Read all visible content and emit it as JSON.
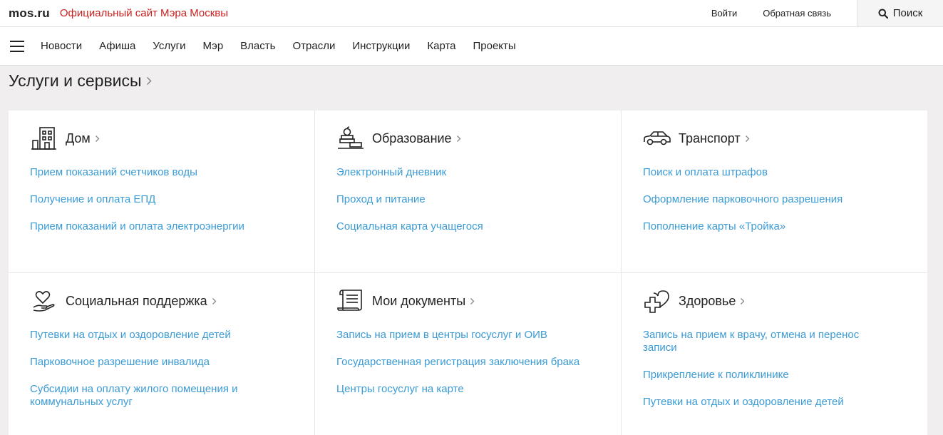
{
  "header": {
    "logo": "mos.ru",
    "site_title": "Официальный сайт Мэра Москвы",
    "login": "Войти",
    "feedback": "Обратная связь",
    "search": "Поиск"
  },
  "nav": {
    "items": [
      "Новости",
      "Афиша",
      "Услуги",
      "Мэр",
      "Власть",
      "Отрасли",
      "Инструкции",
      "Карта",
      "Проекты"
    ]
  },
  "page": {
    "title": "Услуги и сервисы"
  },
  "cards": [
    {
      "title": "Дом",
      "icon": "house-icon",
      "links": [
        "Прием показаний счетчиков воды",
        "Получение и оплата ЕПД",
        "Прием показаний и оплата электроэнергии"
      ]
    },
    {
      "title": "Образование",
      "icon": "education-icon",
      "links": [
        "Электронный дневник",
        "Проход и питание",
        "Социальная карта учащегося"
      ]
    },
    {
      "title": "Транспорт",
      "icon": "car-icon",
      "links": [
        "Поиск и оплата штрафов",
        "Оформление парковочного разрешения",
        "Пополнение карты «Тройка»"
      ]
    },
    {
      "title": "Социальная поддержка",
      "icon": "heart-hand-icon",
      "links": [
        "Путевки на отдых и оздоровление детей",
        "Парковочное разрешение инвалида",
        "Субсидии на оплату жилого помещения и коммунальных услуг"
      ]
    },
    {
      "title": "Мои документы",
      "icon": "document-scroll-icon",
      "links": [
        "Запись на прием в центры госуслуг и ОИВ",
        "Государственная регистрация заключения брака",
        "Центры госуслуг на карте"
      ]
    },
    {
      "title": "Здоровье",
      "icon": "health-cross-icon",
      "links": [
        "Запись на прием к врачу, отмена и перенос записи",
        "Прикрепление к поликлинике",
        "Путевки на отдых и оздоровление детей"
      ]
    }
  ],
  "colors": {
    "brand_red": "#cc1f1f",
    "link_blue": "#3b9bd5",
    "page_bg": "#f0eeee"
  }
}
